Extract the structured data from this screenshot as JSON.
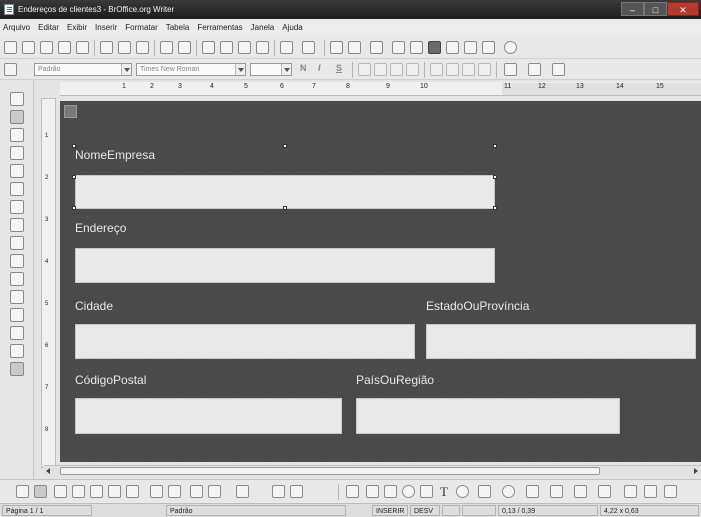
{
  "window": {
    "title": "Endereços de clientes3 - BrOffice.org Writer",
    "controls": {
      "minimize": "–",
      "maximize": "□",
      "close": "✕"
    }
  },
  "menu": [
    "Arquivo",
    "Editar",
    "Exibir",
    "Inserir",
    "Formatar",
    "Tabela",
    "Ferramentas",
    "Janela",
    "Ajuda"
  ],
  "formatting_bar": {
    "style": "Padrão",
    "font": "Times New Roman",
    "size": "",
    "bold": "N",
    "italic": "I",
    "underline": "S"
  },
  "ruler": {
    "ticks": [
      "1",
      "2",
      "3",
      "4",
      "5",
      "6",
      "7",
      "8",
      "9",
      "10",
      "11",
      "12",
      "13",
      "14",
      "15"
    ]
  },
  "vertical_ruler": {
    "ticks": [
      "1",
      "2",
      "3",
      "4",
      "5",
      "6",
      "7",
      "8"
    ]
  },
  "form": {
    "fields": [
      {
        "label": "NomeEmpresa",
        "value": ""
      },
      {
        "label": "Endereço",
        "value": ""
      },
      {
        "label": "Cidade",
        "value": ""
      },
      {
        "label": "EstadoOuProvíncia",
        "value": ""
      },
      {
        "label": "CódigoPostal",
        "value": ""
      },
      {
        "label": "PaísOuRegião",
        "value": ""
      }
    ]
  },
  "drawing_bar": {
    "text_tool": "T"
  },
  "status": {
    "page": "Página 1 / 1",
    "style": "Padrão",
    "mode_insert": "INSERIR",
    "mode_select": "DESV",
    "position": "0,13 / 0,39",
    "size": "4,22 x 0,63"
  }
}
